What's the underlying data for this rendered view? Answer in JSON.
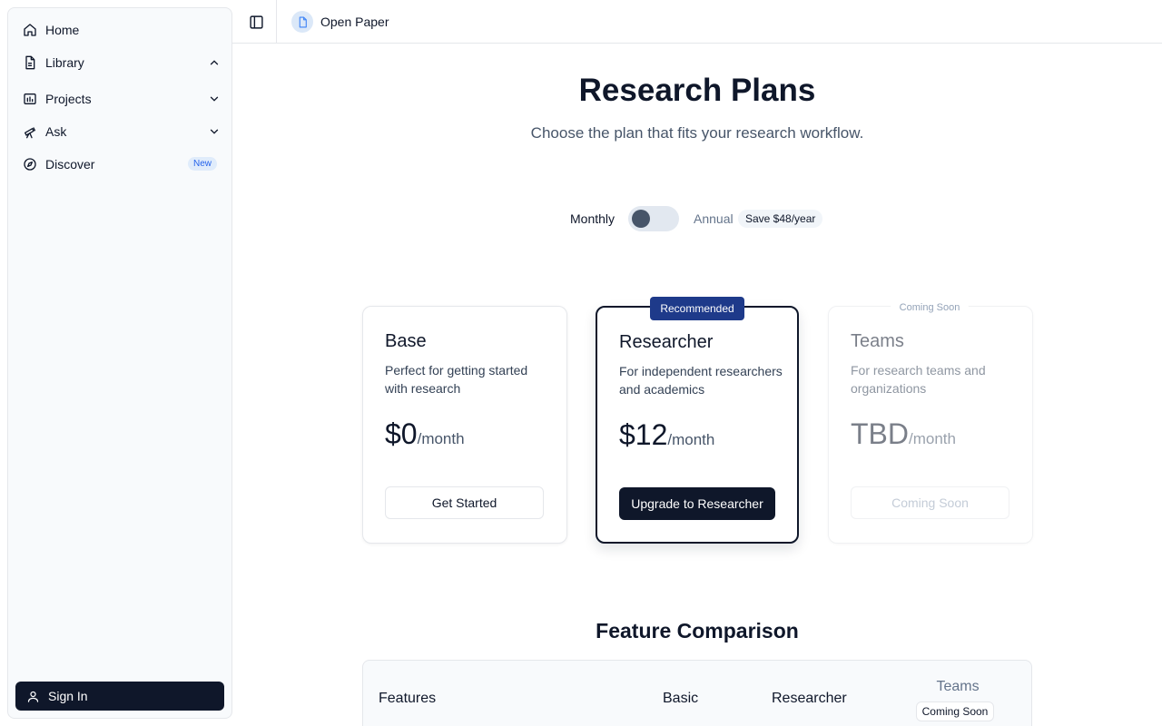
{
  "sidebar": {
    "items": [
      {
        "label": "Home",
        "icon": "home-icon"
      },
      {
        "label": "Library",
        "icon": "document-icon",
        "expanded": true
      },
      {
        "label": "Projects",
        "icon": "chart-icon",
        "expanded": false
      },
      {
        "label": "Ask",
        "icon": "telescope-icon",
        "expanded": false
      },
      {
        "label": "Discover",
        "icon": "compass-icon",
        "badge": "New"
      }
    ],
    "sign_in_label": "Sign In"
  },
  "topbar": {
    "doc_title": "Open Paper"
  },
  "header": {
    "title": "Research Plans",
    "subtitle": "Choose the plan that fits your research workflow."
  },
  "billing": {
    "monthly_label": "Monthly",
    "annual_label": "Annual",
    "save_badge": "Save $48/year",
    "selected": "Monthly"
  },
  "plans": [
    {
      "name": "Base",
      "description": "Perfect for getting started with research",
      "price": "$0",
      "period": "/month",
      "button": "Get Started"
    },
    {
      "name": "Researcher",
      "description": "For independent researchers and academics",
      "price": "$12",
      "period": "/month",
      "button": "Upgrade to Researcher",
      "badge": "Recommended"
    },
    {
      "name": "Teams",
      "description": "For research teams and organizations",
      "price": "TBD",
      "period": "/month",
      "button": "Coming Soon",
      "badge": "Coming Soon"
    }
  ],
  "comparison": {
    "title": "Feature Comparison",
    "headers": [
      "Features",
      "Basic",
      "Researcher",
      "Teams"
    ],
    "teams_badge": "Coming Soon"
  },
  "colors": {
    "primary": "#0f172a",
    "accent": "#1e3a8a",
    "new_badge": "#2563eb"
  }
}
